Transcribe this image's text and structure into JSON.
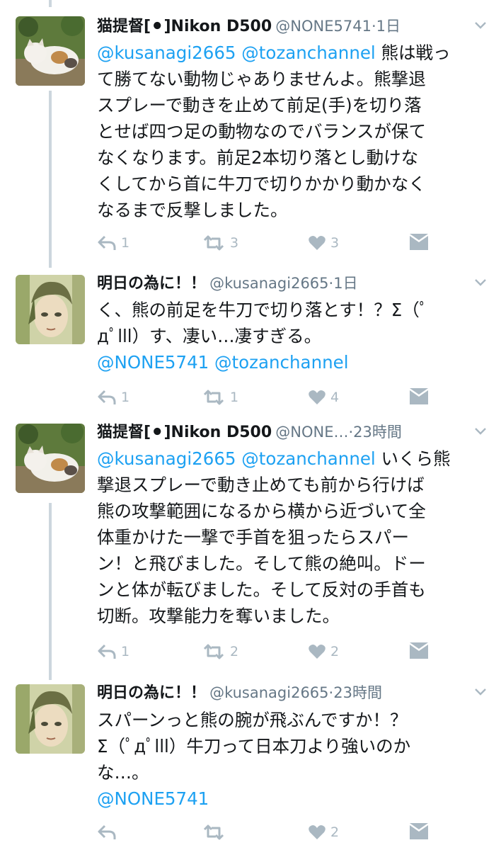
{
  "tweets": [
    {
      "name": "猫提督[⚫]Nikon D500",
      "handle": "@NONE5741",
      "time": "1日",
      "mentions": "@kusanagi2665 @tozanchannel",
      "text_lines": [
        "熊は戦っ",
        "て勝てない動物じゃありませんよ。熊撃退",
        "スプレーで動きを止めて前足(手)を切り落",
        "とせば四つ足の動物なのでバランスが保て",
        "なくなります。前足2本切り落とし動けな",
        "くしてから首に牛刀で切りかかり動かなく",
        "なるまで反撃しました。"
      ],
      "reply_count": "1",
      "retweet_count": "3",
      "like_count": "3"
    },
    {
      "name": "明日の為に！！",
      "handle": "@kusanagi2665",
      "time": "1日",
      "text_lines": [
        "く、熊の前足を牛刀で切り落とす！？Σ（ﾟ",
        "дﾟlll）す、凄い…凄すぎる。"
      ],
      "trailing_mentions": "@NONE5741 @tozanchannel",
      "reply_count": "1",
      "retweet_count": "1",
      "like_count": "4"
    },
    {
      "name": "猫提督[⚫]Nikon D500",
      "handle": "@NONE…",
      "time": "23時間",
      "mentions": "@kusanagi2665 @tozanchannel",
      "text_lines": [
        "いくら熊",
        "撃退スプレーで動き止めても前から行けば",
        "熊の攻撃範囲になるから横から近づいて全",
        "体重かけた一撃で手首を狙ったらスパー",
        "ン！と飛びました。そして熊の絶叫。ドー",
        "ンと体が転びました。そして反対の手首も",
        "切断。攻撃能力を奪いました。"
      ],
      "reply_count": "1",
      "retweet_count": "2",
      "like_count": "2"
    },
    {
      "name": "明日の為に！！",
      "handle": "@kusanagi2665",
      "time": "23時間",
      "text_lines": [
        "スパーンっと熊の腕が飛ぶんですか！？",
        "Σ（ﾟдﾟlll）牛刀って日本刀より強いのか",
        "な…。"
      ],
      "trailing_mentions": "@NONE5741",
      "reply_count": "",
      "retweet_count": "",
      "like_count": "2"
    }
  ],
  "separator": "·",
  "icons": {
    "reply": "reply-arrow-icon",
    "retweet": "retweet-icon",
    "like": "heart-icon",
    "dm": "direct-message-icon",
    "more": "chevron-down-icon"
  },
  "colors": {
    "link": "#1da1f2",
    "meta": "#657786",
    "action": "#aab8c2",
    "thread_line": "#ccd6dd"
  }
}
